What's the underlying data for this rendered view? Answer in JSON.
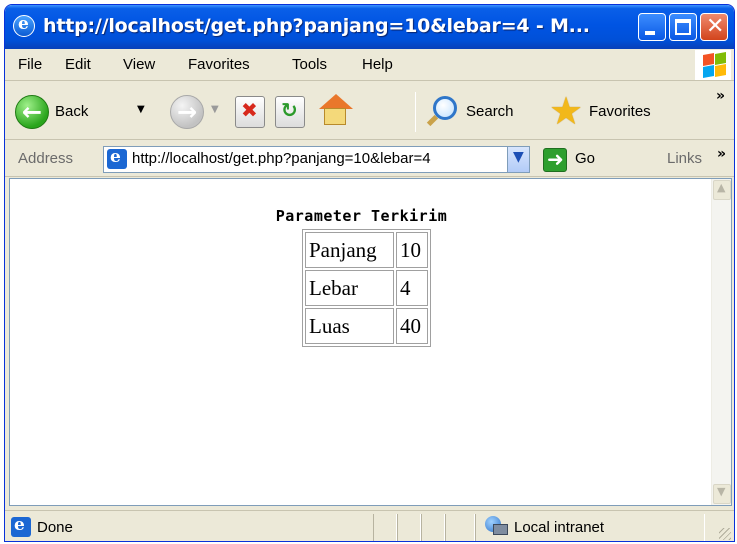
{
  "window": {
    "title": "http://localhost/get.php?panjang=10&lebar=4 - M...",
    "app_icon": "ie-icon",
    "controls": [
      "minimize-icon",
      "maximize-icon",
      "close-icon"
    ]
  },
  "menubar": {
    "items": [
      {
        "label": "File"
      },
      {
        "label": "Edit"
      },
      {
        "label": "View"
      },
      {
        "label": "Favorites"
      },
      {
        "label": "Tools"
      },
      {
        "label": "Help"
      }
    ]
  },
  "toolbar": {
    "back_label": "Back",
    "search_label": "Search",
    "favorites_label": "Favorites",
    "overflow": "»"
  },
  "address": {
    "label": "Address",
    "url": "http://localhost/get.php?panjang=10&lebar=4",
    "go_label": "Go",
    "links_label": "Links",
    "links_overflow": "»"
  },
  "page": {
    "heading": "Parameter Terkirim",
    "rows": [
      {
        "key": "Panjang",
        "value": "10"
      },
      {
        "key": "Lebar",
        "value": "4"
      },
      {
        "key": "Luas",
        "value": "40"
      }
    ]
  },
  "statusbar": {
    "text": "Done",
    "zone": "Local intranet"
  },
  "colors": {
    "titlebar": "#0054e3",
    "chrome": "#ece9d8",
    "close_button": "#d2441c"
  }
}
